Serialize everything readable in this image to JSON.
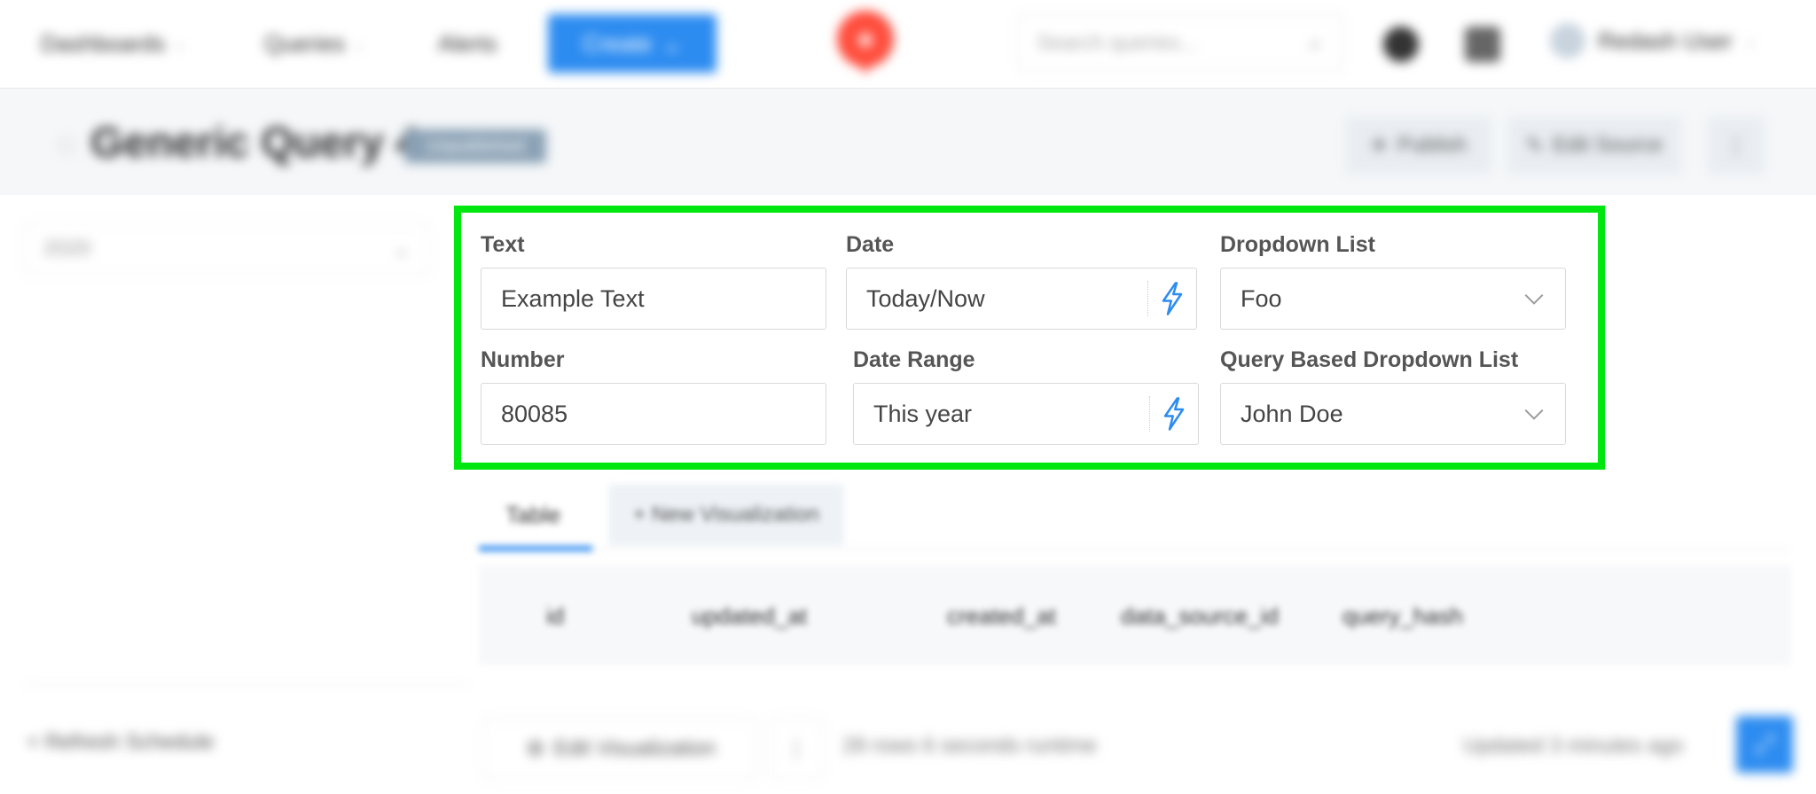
{
  "nav": {
    "dashboards": "Dashboards",
    "queries": "Queries",
    "alerts": "Alerts",
    "create": "Create",
    "search_placeholder": "Search queries...",
    "user_name": "Redash User"
  },
  "header": {
    "title": "Generic Query 4",
    "badge": "Unpublished",
    "publish": "Publish",
    "edit_source": "Edit Source",
    "more": "⋮"
  },
  "sidebar": {
    "schedule_value": "2020",
    "refresh_label": "Refresh Schedule"
  },
  "params": {
    "text_label": "Text",
    "text_value": "Example Text",
    "date_label": "Date",
    "date_value": "Today/Now",
    "dropdown_label": "Dropdown List",
    "dropdown_value": "Foo",
    "number_label": "Number",
    "number_value": "80085",
    "daterange_label": "Date Range",
    "daterange_value": "This year",
    "querydropdown_label": "Query Based Dropdown List",
    "querydropdown_value": "John Doe"
  },
  "results": {
    "tab_table": "Table",
    "tab_new": "+ New Visualization",
    "columns": [
      "id",
      "updated_at",
      "created_at",
      "data_source_id",
      "query_hash"
    ]
  },
  "footer": {
    "edit_visualization": "Edit Visualization",
    "more": "⋮",
    "rows_info": "28 rows  6 seconds runtime",
    "updated": "Updated 3 minutes ago"
  },
  "colors": {
    "accent": "#2d8cf0",
    "highlight": "#00e60f",
    "logo": "#ff4d3d"
  }
}
